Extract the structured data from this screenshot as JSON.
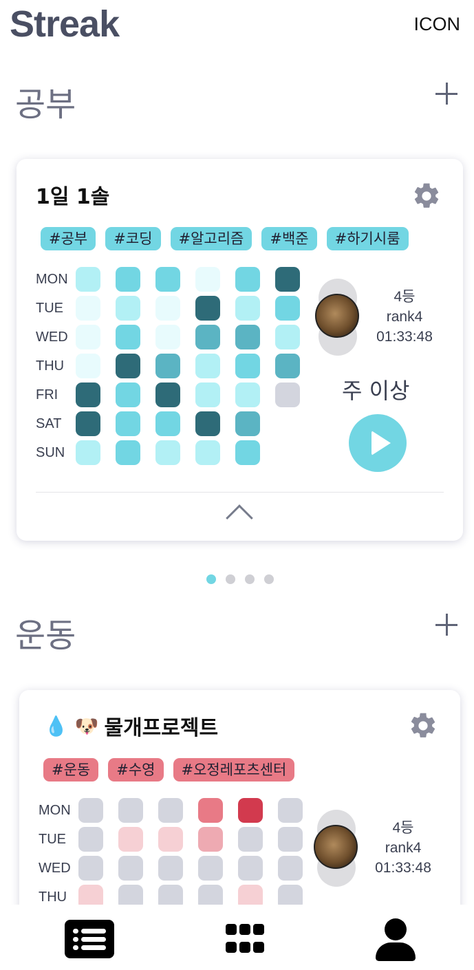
{
  "header": {
    "title": "Streak",
    "icon_label": "ICON"
  },
  "sections": [
    {
      "title": "공부",
      "card": {
        "title": "1일 1솔",
        "emoji": "",
        "tags": [
          "#공부",
          "#코딩",
          "#알고리즘",
          "#백준",
          "#하기시룸"
        ],
        "tag_color": "#72d6e3",
        "days": [
          "MON",
          "TUE",
          "WED",
          "THU",
          "FRI",
          "SAT",
          "SUN"
        ],
        "grid": [
          [
            "#b2f0f5",
            "#72d6e3",
            "#72d6e3",
            "#e8fbfd",
            "#72d6e3",
            "#2e6b78"
          ],
          [
            "#e8fbfd",
            "#b2f0f5",
            "#e8fbfd",
            "#2e6b78",
            "#b2f0f5",
            "#72d6e3"
          ],
          [
            "#e8fbfd",
            "#72d6e3",
            "#e8fbfd",
            "#5bb4c3",
            "#5bb4c3",
            "#b2f0f5"
          ],
          [
            "#e8fbfd",
            "#2e6b78",
            "#5bb4c3",
            "#b2f0f5",
            "#72d6e3",
            "#5bb4c3"
          ],
          [
            "#2e6b78",
            "#72d6e3",
            "#2e6b78",
            "#b2f0f5",
            "#b2f0f5",
            "#d3d5de"
          ],
          [
            "#2e6b78",
            "#72d6e3",
            "#72d6e3",
            "#2e6b78",
            "#5bb4c3",
            null
          ],
          [
            "#b2f0f5",
            "#72d6e3",
            "#b2f0f5",
            "#b2f0f5",
            "#72d6e3",
            null
          ]
        ],
        "rank": {
          "place": "4등",
          "rank": "rank4",
          "time": "01:33:48"
        },
        "week_status": "주 이상"
      }
    },
    {
      "title": "운동",
      "card": {
        "title": "물개프로젝트",
        "emoji": "💧 🐶",
        "tags": [
          "#운동",
          "#수영",
          "#오정레포츠센터"
        ],
        "tag_color": "#e87a86",
        "days": [
          "MON",
          "TUE",
          "WED",
          "THU"
        ],
        "grid": [
          [
            "#d3d5de",
            "#d3d5de",
            "#d3d5de",
            "#e87a86",
            "#d23a4e",
            "#d3d5de"
          ],
          [
            "#d3d5de",
            "#f6d0d4",
            "#f6d0d4",
            "#eeaab2",
            "#d3d5de",
            "#d3d5de"
          ],
          [
            "#d3d5de",
            "#d3d5de",
            "#d3d5de",
            "#d3d5de",
            "#d3d5de",
            "#d3d5de"
          ],
          [
            "#f6d0d4",
            "#d3d5de",
            "#d3d5de",
            "#d3d5de",
            "#f6d0d4",
            "#d3d5de"
          ]
        ],
        "rank": {
          "place": "4등",
          "rank": "rank4",
          "time": "01:33:48"
        }
      }
    }
  ],
  "pagination": {
    "count": 4,
    "active": 0
  },
  "nav": [
    {
      "name": "list-icon",
      "label": "List"
    },
    {
      "name": "grid-icon",
      "label": "Grid"
    },
    {
      "name": "user-icon",
      "label": "Profile"
    }
  ]
}
